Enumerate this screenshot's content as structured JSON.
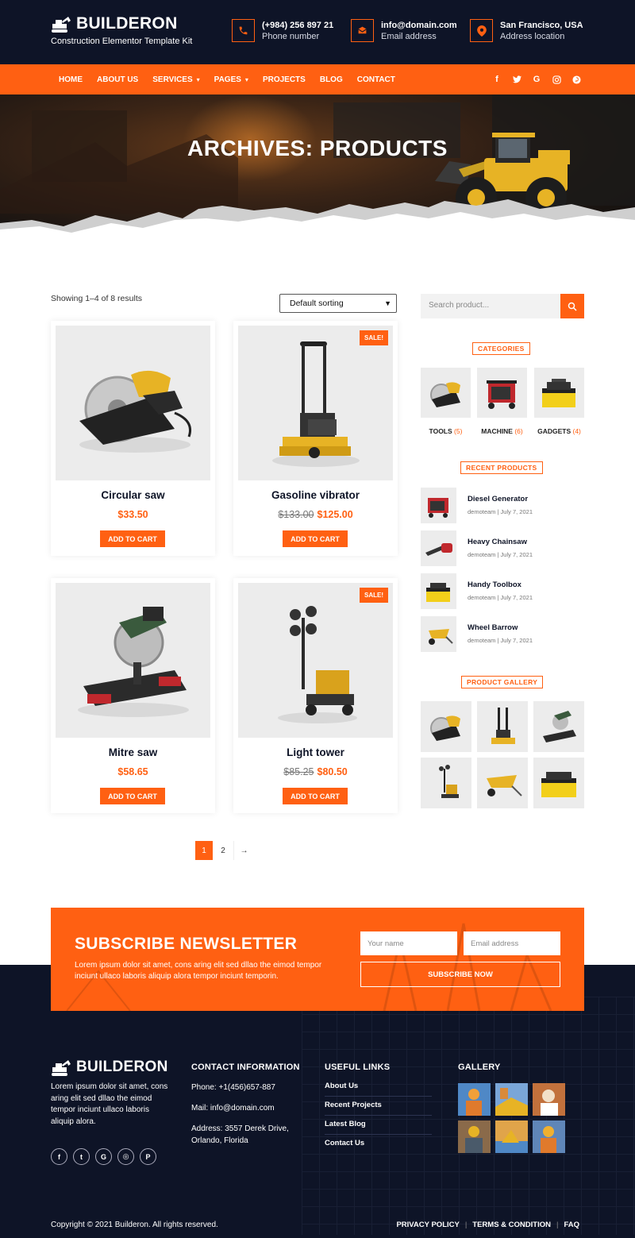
{
  "brand": {
    "name": "BUILDERON",
    "tagline": "Construction Elementor Template Kit",
    "accent_color": "#ff6012",
    "dark_color": "#0e1427"
  },
  "header_contacts": [
    {
      "icon": "phone-icon",
      "value": "(+984) 256 897 21",
      "label": "Phone number"
    },
    {
      "icon": "email-icon",
      "value": "info@domain.com",
      "label": "Email address"
    },
    {
      "icon": "location-pin-icon",
      "value": "San Francisco, USA",
      "label": "Address location"
    }
  ],
  "nav": {
    "items": [
      {
        "label": "HOME",
        "has_dropdown": false
      },
      {
        "label": "ABOUT US",
        "has_dropdown": false
      },
      {
        "label": "SERVICES",
        "has_dropdown": true
      },
      {
        "label": "PAGES",
        "has_dropdown": true
      },
      {
        "label": "PROJECTS",
        "has_dropdown": false
      },
      {
        "label": "BLOG",
        "has_dropdown": false
      },
      {
        "label": "CONTACT",
        "has_dropdown": false
      }
    ],
    "social_icons": [
      "facebook-icon",
      "twitter-icon",
      "google-icon",
      "instagram-icon",
      "pinterest-icon"
    ],
    "social_glyphs": [
      "f",
      "t",
      "G",
      "◎",
      "P"
    ]
  },
  "hero": {
    "title": "ARCHIVES: PRODUCTS"
  },
  "shop": {
    "result_count": "Showing 1–4 of 8 results",
    "sort_selected": "Default sorting",
    "add_to_cart_label": "ADD TO CART",
    "sale_badge": "SALE!",
    "products": [
      {
        "name": "Circular saw",
        "price": "$33.50",
        "old_price": null,
        "on_sale": false,
        "image": "circular-saw"
      },
      {
        "name": "Gasoline vibrator",
        "price": "$125.00",
        "old_price": "$133.00",
        "on_sale": true,
        "image": "plate-compactor"
      },
      {
        "name": "Mitre saw",
        "price": "$58.65",
        "old_price": null,
        "on_sale": false,
        "image": "mitre-saw"
      },
      {
        "name": "Light tower",
        "price": "$80.50",
        "old_price": "$85.25",
        "on_sale": true,
        "image": "light-tower"
      }
    ],
    "pagination": {
      "current": "1",
      "pages": [
        "1",
        "2"
      ],
      "next": "→"
    }
  },
  "sidebar": {
    "search_placeholder": "Search product...",
    "categories_title": "CATEGORIES",
    "categories": [
      {
        "name": "TOOLS",
        "count": "(5)",
        "image": "circular-saw"
      },
      {
        "name": "MACHINE",
        "count": "(6)",
        "image": "generator"
      },
      {
        "name": "GADGETS",
        "count": "(4)",
        "image": "toolbox"
      }
    ],
    "recent_title": "RECENT PRODUCTS",
    "recent": [
      {
        "name": "Diesel Generator",
        "meta": "demoteam | July 7, 2021",
        "image": "generator"
      },
      {
        "name": "Heavy Chainsaw",
        "meta": "demoteam | July 7, 2021",
        "image": "chainsaw"
      },
      {
        "name": "Handy Toolbox",
        "meta": "demoteam | July 7, 2021",
        "image": "toolbox"
      },
      {
        "name": "Wheel Barrow",
        "meta": "demoteam | July 7, 2021",
        "image": "wheelbarrow"
      }
    ],
    "gallery_title": "PRODUCT GALLERY",
    "gallery": [
      "circular-saw",
      "plate-compactor",
      "mitre-saw",
      "light-tower",
      "wheelbarrow",
      "toolbox"
    ]
  },
  "newsletter": {
    "title": "SUBSCRIBE NEWSLETTER",
    "text": "Lorem ipsum dolor sit amet, cons aring elit sed dllao the eimod tempor inciunt ullaco laboris aliquip alora tempor inciunt temporin.",
    "name_placeholder": "Your name",
    "email_placeholder": "Email address",
    "button": "SUBSCRIBE NOW"
  },
  "footer": {
    "about": "Lorem ipsum dolor sit amet, cons aring elit sed dllao the eimod tempor inciunt ullaco laboris aliquip alora.",
    "social_icons": [
      "facebook-icon",
      "twitter-icon",
      "google-icon",
      "instagram-icon",
      "pinterest-icon"
    ],
    "social_glyphs": [
      "f",
      "t",
      "G",
      "◎",
      "P"
    ],
    "contact_title": "CONTACT INFORMATION",
    "phone": "Phone: +1(456)657-887",
    "mail": "Mail: info@domain.com",
    "address": "Address: 3557 Derek Drive, Orlando, Florida",
    "links_title": "USEFUL LINKS",
    "links": [
      "About Us",
      "Recent Projects",
      "Latest Blog",
      "Contact Us"
    ],
    "gallery_title": "GALLERY",
    "gallery_colors": [
      "#d98a3a",
      "#4f88c6",
      "#c2713c",
      "#8a6a4a",
      "#e0a44a",
      "#5f86b8"
    ],
    "copyright": "Copyright © 2021 Builderon. All rights reserved.",
    "legal": [
      "PRIVACY POLICY",
      "TERMS & CONDITION",
      "FAQ"
    ]
  }
}
